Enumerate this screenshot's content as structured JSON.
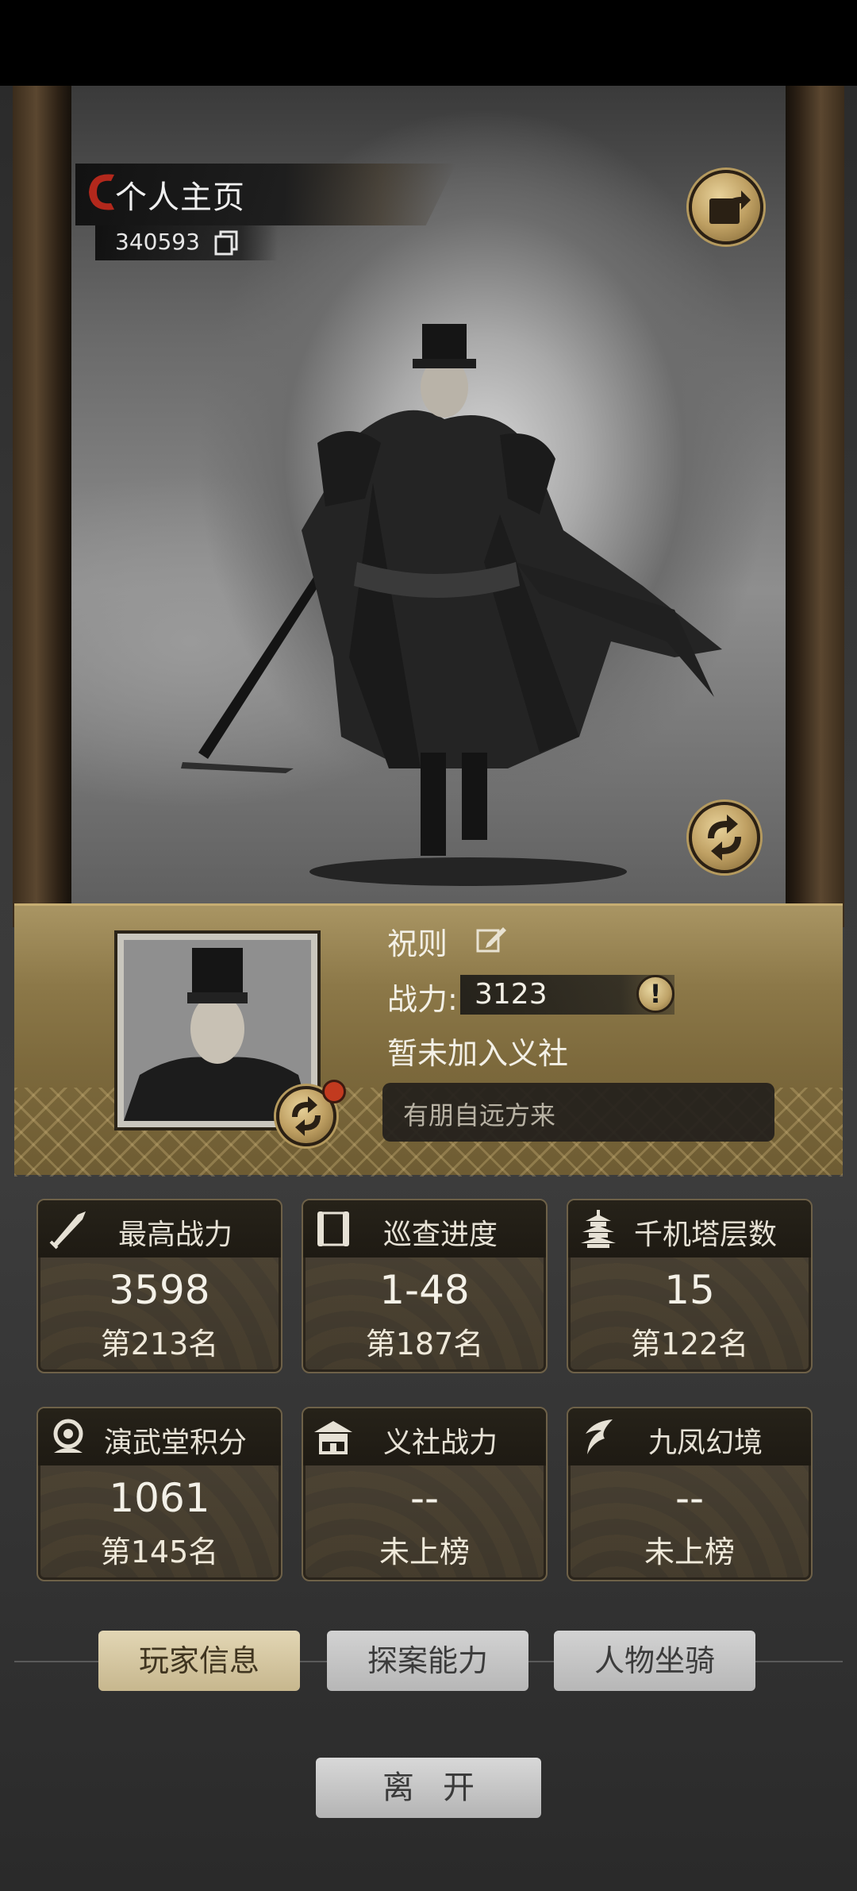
{
  "header": {
    "title": "个人主页",
    "player_id": "340593"
  },
  "profile": {
    "name": "祝则",
    "power_label": "战力:",
    "power_value": "3123",
    "power_info_glyph": "!",
    "guild_status": "暂未加入义社",
    "motto": "有朋自远方来"
  },
  "stats": [
    {
      "label": "最高战力",
      "value": "3598",
      "rank": "第213名",
      "icon": "sword-icon"
    },
    {
      "label": "巡查进度",
      "value": "1-48",
      "rank": "第187名",
      "icon": "scroll-icon"
    },
    {
      "label": "千机塔层数",
      "value": "15",
      "rank": "第122名",
      "icon": "pagoda-icon"
    },
    {
      "label": "演武堂积分",
      "value": "1061",
      "rank": "第145名",
      "icon": "medal-icon"
    },
    {
      "label": "义社战力",
      "value": "--",
      "rank": "未上榜",
      "icon": "guild-hall-icon"
    },
    {
      "label": "九凤幻境",
      "value": "--",
      "rank": "未上榜",
      "icon": "phoenix-icon"
    }
  ],
  "tabs": [
    {
      "label": "玩家信息",
      "active": true
    },
    {
      "label": "探案能力",
      "active": false
    },
    {
      "label": "人物坐骑",
      "active": false
    }
  ],
  "leave_button": "离开",
  "colors": {
    "gold": "#bfa063",
    "panel": "#8c7848",
    "card": "#3e372b",
    "alert_dot": "#c23a1f"
  }
}
